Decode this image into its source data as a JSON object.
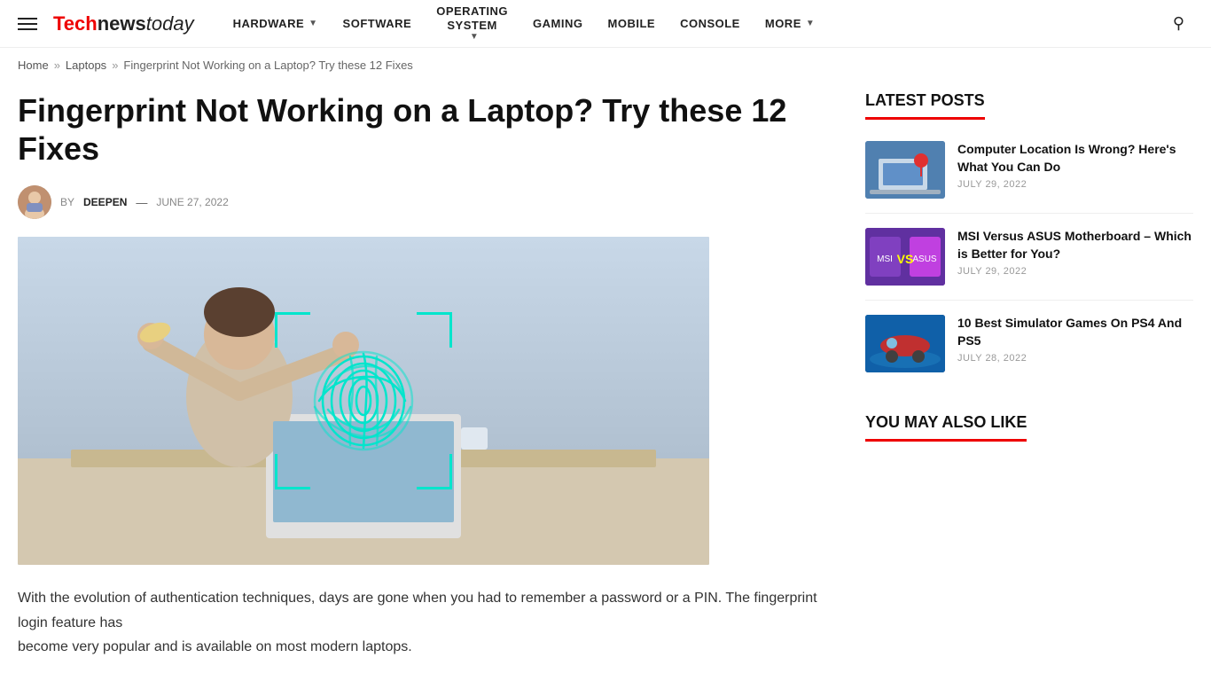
{
  "header": {
    "hamburger_label": "menu",
    "logo": {
      "tech": "Tech",
      "news": "news",
      "today": "today"
    },
    "nav": [
      {
        "id": "hardware",
        "label": "HARDWARE",
        "has_dropdown": true
      },
      {
        "id": "software",
        "label": "SOFTWARE",
        "has_dropdown": false
      },
      {
        "id": "operating",
        "label": "OPERATING SYSTEM",
        "has_dropdown": true
      },
      {
        "id": "gaming",
        "label": "GAMING",
        "has_dropdown": false
      },
      {
        "id": "mobile",
        "label": "MOBILE",
        "has_dropdown": false
      },
      {
        "id": "console",
        "label": "CONSOLE",
        "has_dropdown": false
      },
      {
        "id": "more",
        "label": "MORE",
        "has_dropdown": true
      }
    ]
  },
  "breadcrumb": {
    "home": "Home",
    "laptops": "Laptops",
    "current": "Fingerprint Not Working on a Laptop? Try these 12 Fixes"
  },
  "article": {
    "title": "Fingerprint Not Working on a Laptop? Try these 12 Fixes",
    "author_label": "BY",
    "author": "DEEPEN",
    "date_separator": "—",
    "date": "JUNE 27, 2022",
    "body_para1": "With the evolution of authentication techniques, days are gone when you had to remember a password or a PIN. The fingerprint login feature has",
    "body_para2": "become very popular and is available on most modern laptops."
  },
  "sidebar": {
    "latest_posts_title": "LATEST POSTS",
    "posts": [
      {
        "id": 1,
        "title": "Computer Location Is Wrong? Here's What You Can Do",
        "date": "JULY 29, 2022",
        "thumb_class": "post-thumb-1"
      },
      {
        "id": 2,
        "title": "MSI Versus ASUS Motherboard – Which is Better for You?",
        "date": "JULY 29, 2022",
        "thumb_class": "post-thumb-2"
      },
      {
        "id": 3,
        "title": "10 Best Simulator Games On PS4 And PS5",
        "date": "JULY 28, 2022",
        "thumb_class": "post-thumb-3"
      }
    ],
    "you_may_also_like_title": "YOU MAY ALSO LIKE"
  }
}
